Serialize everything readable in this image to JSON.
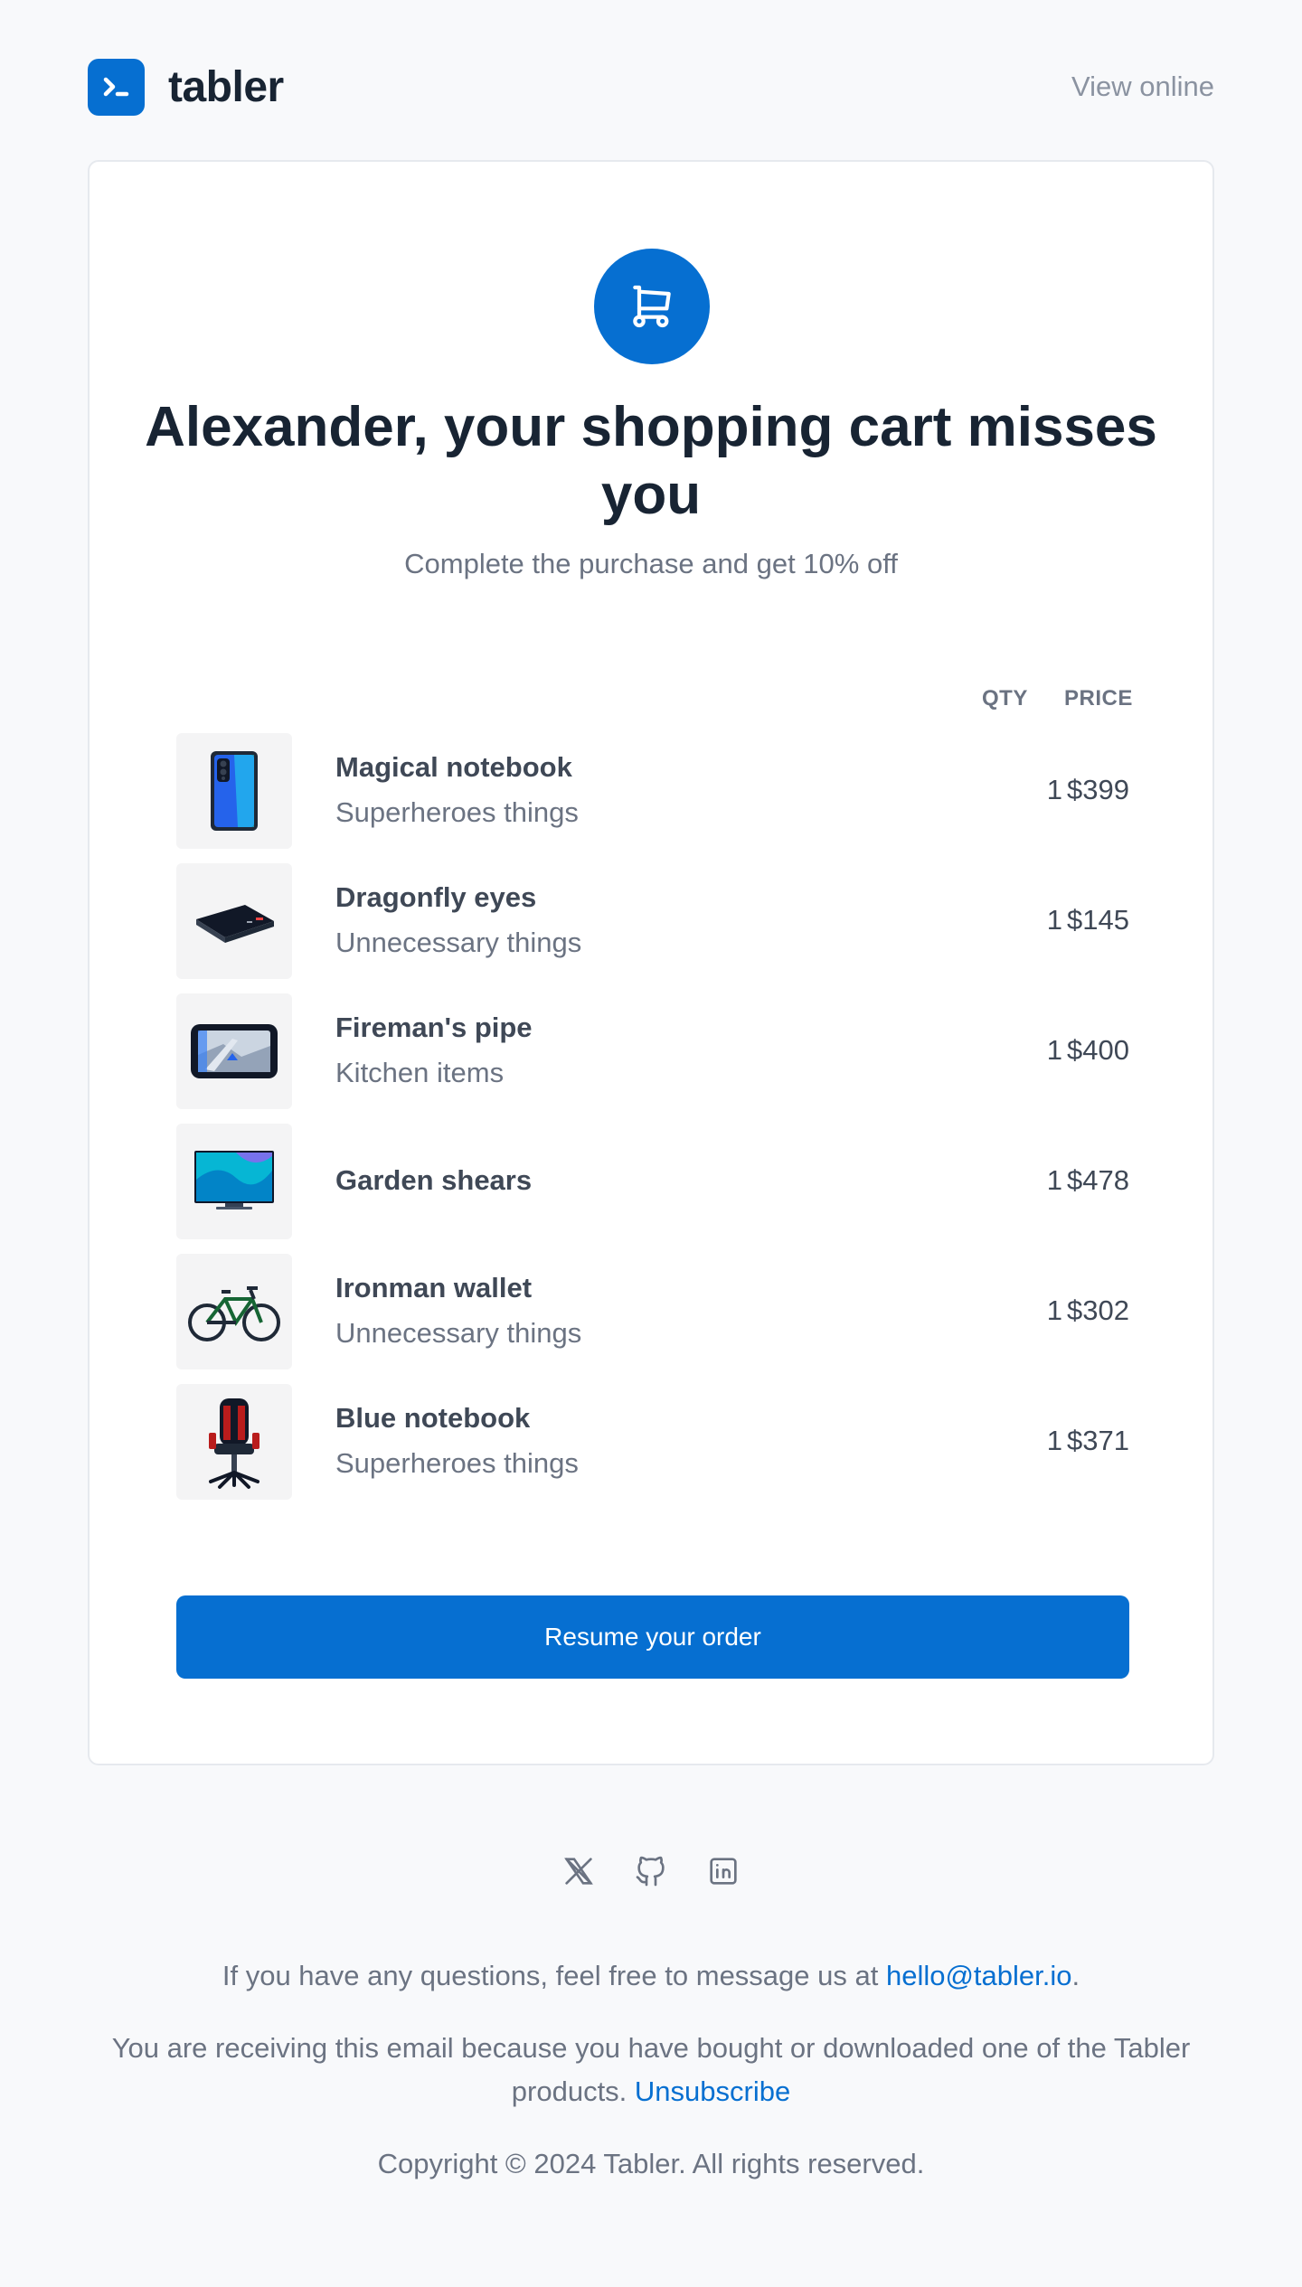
{
  "header": {
    "brand_name": "tabler",
    "view_online": "View online"
  },
  "hero": {
    "icon": "shopping-cart-icon",
    "title": "Alexander, your shopping cart misses you",
    "subtitle": "Complete the purchase and get 10% off"
  },
  "table": {
    "qty_label": "QTY",
    "price_label": "PRICE",
    "items": [
      {
        "name": "Magical notebook",
        "category": "Superheroes things",
        "qty": "1",
        "price": "$399",
        "icon": "smartphone-icon"
      },
      {
        "name": "Dragonfly eyes",
        "category": "Unnecessary things",
        "qty": "1",
        "price": "$145",
        "icon": "power-bank-icon"
      },
      {
        "name": "Fireman's pipe",
        "category": "Kitchen items",
        "qty": "1",
        "price": "$400",
        "icon": "gps-navigator-icon"
      },
      {
        "name": "Garden shears",
        "category": "",
        "qty": "1",
        "price": "$478",
        "icon": "television-icon"
      },
      {
        "name": "Ironman wallet",
        "category": "Unnecessary things",
        "qty": "1",
        "price": "$302",
        "icon": "bicycle-icon"
      },
      {
        "name": "Blue notebook",
        "category": "Superheroes things",
        "qty": "1",
        "price": "$371",
        "icon": "gaming-chair-icon"
      }
    ]
  },
  "cta": {
    "label": "Resume your order"
  },
  "footer": {
    "social": [
      "x-icon",
      "github-icon",
      "linkedin-icon"
    ],
    "contact_prefix": "If you have any questions, feel free to message us at ",
    "contact_email": "hello@tabler.io",
    "contact_suffix": ".",
    "receiving_text": "You are receiving this email because you have bought or downloaded one of the Tabler products. ",
    "unsubscribe": "Unsubscribe",
    "copyright": "Copyright © 2024 Tabler. All rights reserved."
  },
  "colors": {
    "primary": "#066fd1",
    "background": "#f8f9fb",
    "text_muted": "#6b7382"
  }
}
